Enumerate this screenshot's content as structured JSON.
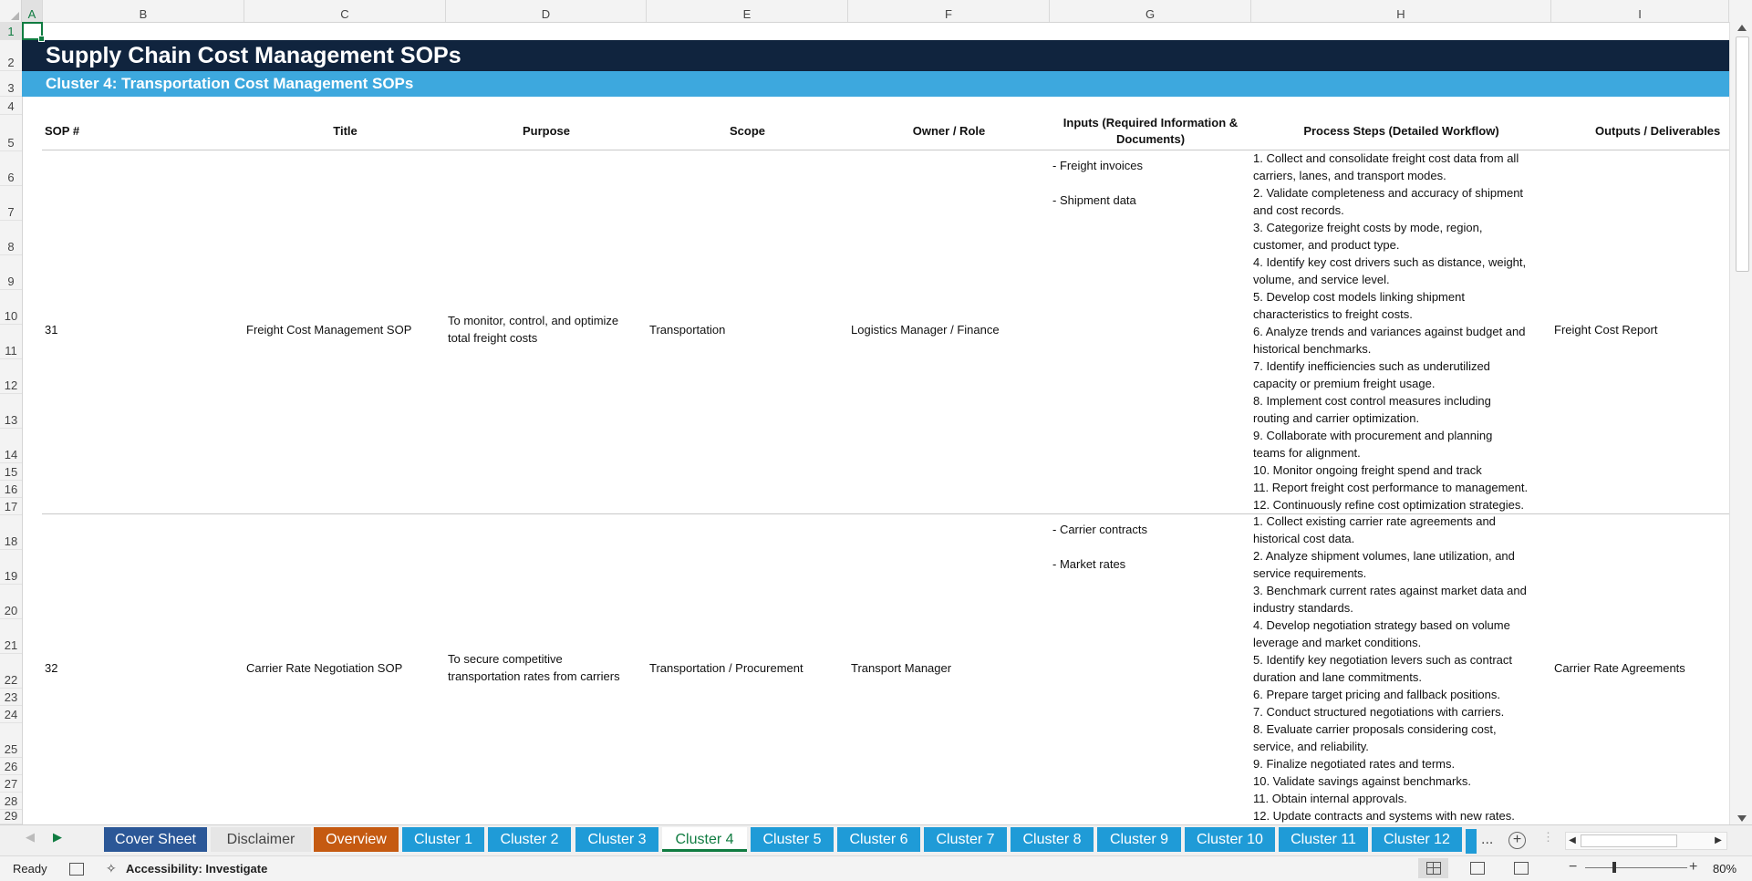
{
  "columns": [
    "A",
    "B",
    "C",
    "D",
    "E",
    "F",
    "G",
    "H",
    "I"
  ],
  "rows": [
    "1",
    "2",
    "3",
    "4",
    "5",
    "6",
    "7",
    "8",
    "9",
    "10",
    "11",
    "12",
    "13",
    "14",
    "15",
    "16",
    "17",
    "18",
    "19",
    "20",
    "21",
    "22",
    "23",
    "24",
    "25",
    "26",
    "27",
    "28",
    "29"
  ],
  "sheet_title": "Supply Chain Cost Management SOPs",
  "sheet_subtitle": "Cluster 4: Transportation Cost Management SOPs",
  "headers": {
    "sop": "SOP #",
    "title": "Title",
    "purpose": "Purpose",
    "scope": "Scope",
    "owner": "Owner / Role",
    "inputs_line1": "Inputs (Required Information &",
    "inputs_line2": "Documents)",
    "process": "Process Steps (Detailed Workflow)",
    "outputs": "Outputs / Deliverables"
  },
  "sops": [
    {
      "number": "31",
      "title": "Freight Cost Management SOP",
      "purpose_line1": "To monitor, control, and optimize",
      "purpose_line2": "total freight costs",
      "scope": "Transportation",
      "owner": "Logistics Manager / Finance",
      "inputs": [
        "- Freight invoices",
        "- Shipment data"
      ],
      "steps": [
        "1. Collect and consolidate freight cost data from all",
        "carriers, lanes, and transport modes.",
        "2. Validate completeness and accuracy of shipment",
        "and cost records.",
        "3. Categorize freight costs by mode, region,",
        "customer, and product type.",
        "4. Identify key cost drivers such as distance, weight,",
        "volume, and service level.",
        "5. Develop cost models linking shipment",
        "characteristics to freight costs.",
        "6. Analyze trends and variances against budget and",
        "historical benchmarks.",
        "7. Identify inefficiencies such as underutilized",
        "capacity or premium freight usage.",
        "8. Implement cost control measures including",
        "routing and carrier optimization.",
        "9. Collaborate with procurement and planning",
        "teams for alignment.",
        "10. Monitor ongoing freight spend and track",
        "11. Report freight cost performance to management.",
        "12. Continuously refine cost optimization strategies."
      ],
      "output": "Freight Cost Report"
    },
    {
      "number": "32",
      "title": "Carrier Rate Negotiation SOP",
      "purpose_line1": "To secure competitive",
      "purpose_line2": "transportation rates from carriers",
      "scope": "Transportation / Procurement",
      "owner": "Transport Manager",
      "inputs": [
        "- Carrier contracts",
        "- Market rates"
      ],
      "steps": [
        "1. Collect existing carrier rate agreements and",
        "historical cost data.",
        "2. Analyze shipment volumes, lane utilization, and",
        "service requirements.",
        "3. Benchmark current rates against market data and",
        "industry standards.",
        "4. Develop negotiation strategy based on volume",
        "leverage and market conditions.",
        "5. Identify key negotiation levers such as contract",
        "duration and lane commitments.",
        "6. Prepare target pricing and fallback positions.",
        "7. Conduct structured negotiations with carriers.",
        "8. Evaluate carrier proposals considering cost,",
        "service, and reliability.",
        "9. Finalize negotiated rates and terms.",
        "10. Validate savings against benchmarks.",
        "11. Obtain internal approvals.",
        "12. Update contracts and systems with new rates."
      ],
      "output": "Carrier Rate Agreements"
    }
  ],
  "tabs": [
    {
      "label": "Cover Sheet",
      "color": "#2b5797"
    },
    {
      "label": "Disclaimer",
      "color": "#e6e6e6"
    },
    {
      "label": "Overview",
      "color": "#c55a11"
    },
    {
      "label": "Cluster 1",
      "color": "#1f9bd7"
    },
    {
      "label": "Cluster 2",
      "color": "#1f9bd7"
    },
    {
      "label": "Cluster 3",
      "color": "#1f9bd7"
    },
    {
      "label": "Cluster 4",
      "color": "#ffffff"
    },
    {
      "label": "Cluster 5",
      "color": "#1f9bd7"
    },
    {
      "label": "Cluster 6",
      "color": "#1f9bd7"
    },
    {
      "label": "Cluster 7",
      "color": "#1f9bd7"
    },
    {
      "label": "Cluster 8",
      "color": "#1f9bd7"
    },
    {
      "label": "Cluster 9",
      "color": "#1f9bd7"
    },
    {
      "label": "Cluster 10",
      "color": "#1f9bd7"
    },
    {
      "label": "Cluster 11",
      "color": "#1f9bd7"
    },
    {
      "label": "Cluster 12",
      "color": "#1f9bd7"
    }
  ],
  "tab_overflow": "...",
  "status": {
    "ready": "Ready",
    "accessibility": "Accessibility: Investigate",
    "zoom": "80%"
  },
  "colors": {
    "title_band": "#10243e",
    "subtitle_band": "#3da8de",
    "tab_blue": "#1f9bd7",
    "active_tab_text": "#107c41",
    "selection": "#107c41"
  }
}
